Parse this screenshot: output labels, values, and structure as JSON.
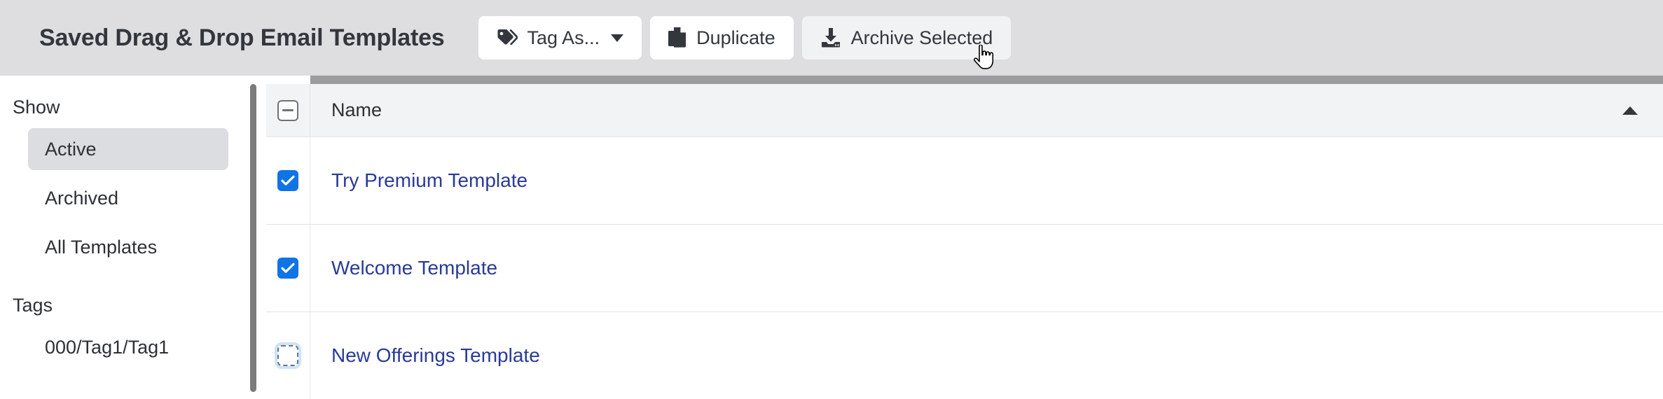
{
  "toolbar": {
    "title": "Saved Drag & Drop Email Templates",
    "buttons": [
      {
        "label": "Tag As...",
        "icon": "tags-icon",
        "state": "default",
        "has_caret": true
      },
      {
        "label": "Duplicate",
        "icon": "copy-icon",
        "state": "default",
        "has_caret": false
      },
      {
        "label": "Archive Selected",
        "icon": "archive-download-icon",
        "state": "hovered",
        "has_caret": false
      }
    ]
  },
  "sidebar": {
    "show_heading": "Show",
    "show_items": [
      {
        "label": "Active",
        "selected": true
      },
      {
        "label": "Archived",
        "selected": false
      },
      {
        "label": "All Templates",
        "selected": false
      }
    ],
    "tags_heading": "Tags",
    "tags": [
      {
        "label": "000/Tag1/Tag1"
      }
    ]
  },
  "table": {
    "select_all_state": "indeterminate",
    "columns": [
      {
        "label": "Name",
        "sort": "asc"
      }
    ],
    "rows": [
      {
        "name": "Try Premium Template",
        "checked": "checked"
      },
      {
        "name": "Welcome Template",
        "checked": "checked"
      },
      {
        "name": "New Offerings Template",
        "checked": "unchecked-focused"
      }
    ]
  },
  "colors": {
    "toolbar_bg": "#dedee1",
    "link_blue": "#2a3a96",
    "checkbox_blue": "#1073e6",
    "selected_item_bg": "#dcdde0",
    "header_bg": "#f2f3f4",
    "scrollbar": "#7b7b7b"
  },
  "cursor": {
    "type": "pointer-hand"
  }
}
